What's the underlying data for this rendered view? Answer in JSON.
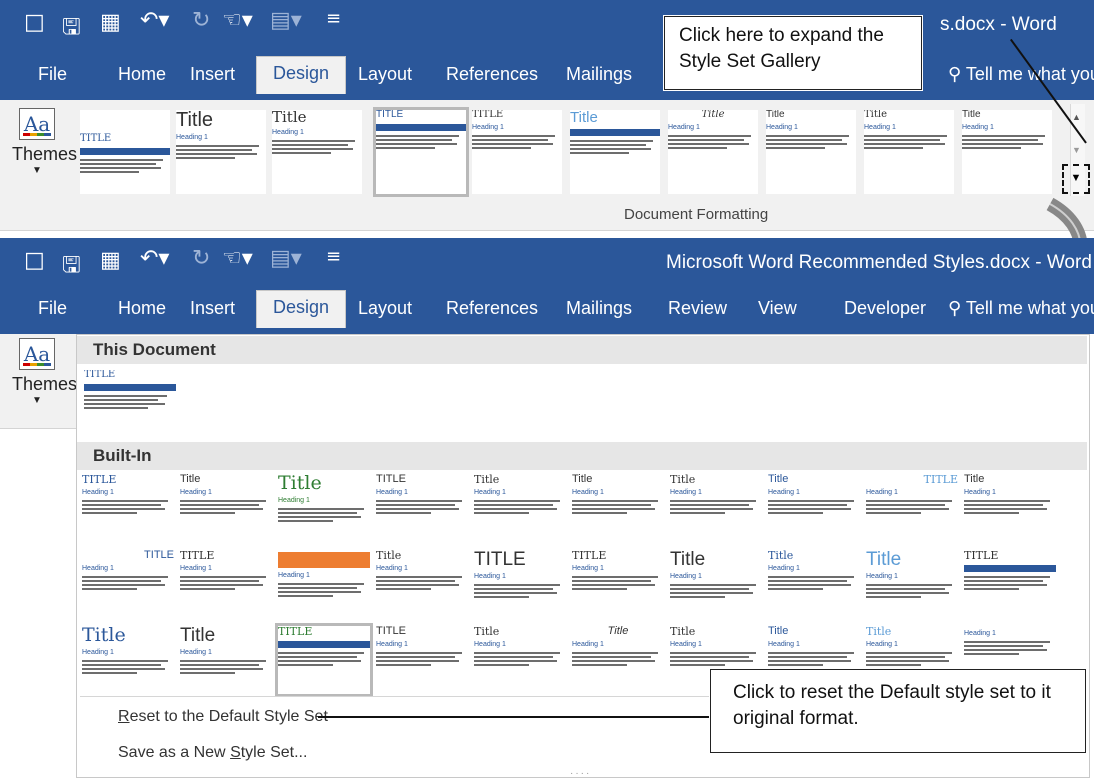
{
  "top": {
    "doc_title": "s.docx - Word",
    "tabs": [
      "File",
      "Home",
      "Insert",
      "Design",
      "Layout",
      "References",
      "Mailings"
    ],
    "tell_me": "Tell me what you",
    "themes_label": "Themes",
    "gallery_label": "Document Formatting",
    "thumbs": [
      "TITLE",
      "Title",
      "Title",
      "TITLE",
      "TITLE",
      "Title",
      "Title",
      "Title",
      "Title",
      "Title"
    ],
    "heading": "Heading 1"
  },
  "bottom": {
    "doc_title": "Microsoft Word Recommended Styles.docx - Word",
    "tabs": [
      "File",
      "Home",
      "Insert",
      "Design",
      "Layout",
      "References",
      "Mailings",
      "Review",
      "View",
      "Developer"
    ],
    "tell_me": "Tell me what you",
    "themes_label": "Themes",
    "this_document": "This Document",
    "built_in": "Built-In",
    "this_doc_thumb_title": "TITLE",
    "grid_titles": [
      [
        "TITLE",
        "Title",
        "Title",
        "TITLE",
        "Title",
        "Title",
        "Title",
        "Title",
        "TITLE",
        "Title"
      ],
      [
        "TITLE",
        "TITLE",
        "",
        "Title",
        "TITLE",
        "TITLE",
        "Title",
        "Title",
        "Title",
        "TITLE"
      ],
      [
        "Title",
        "Title",
        "TITLE",
        "TITLE",
        "Title",
        "Title",
        "Title",
        "Title",
        "Title",
        ""
      ]
    ],
    "heading": "Heading 1",
    "reset": "Reset to the Default Style Set",
    "reset_underline": "R",
    "save_new": "Save as a New Style Set...",
    "save_underline": "S"
  },
  "callouts": {
    "expand": "Click here to expand the Style Set Gallery",
    "reset": "Click to reset the Default style set to it original format."
  }
}
